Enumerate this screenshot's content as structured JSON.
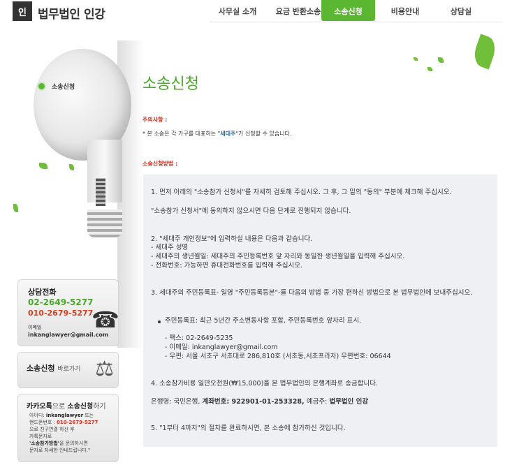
{
  "logo": {
    "mark": "인",
    "name": "법무법인 인강"
  },
  "nav": {
    "items": [
      {
        "label": "사무실 소개"
      },
      {
        "label": "요금 반환소송"
      },
      {
        "label": "소송신청"
      },
      {
        "label": "비용안내"
      },
      {
        "label": "상담실"
      }
    ],
    "active_index": 2
  },
  "bulb": {
    "label": "소송신청"
  },
  "sidebar": {
    "phone_box": {
      "title": "상담전화",
      "phone1": "02-2649-5277",
      "phone2": "010-2679-5277",
      "email_label": "이메일",
      "email": "inkanglawyer@gmail.com"
    },
    "apply_box": {
      "title": "소송신청",
      "title_suffix": "바로가기"
    },
    "kakao_box": {
      "title_main": "카카오톡",
      "title_mid": "으로 ",
      "title_bold": "소송신청",
      "title_end": "하기",
      "line1_prefix": "아이디: ",
      "line1_id": "inkanglawyer",
      "line1_suffix": " 또는",
      "line2_prefix": "핸드폰번호 : ",
      "line2_num": "010-2679-5277",
      "line3": "으로 친구연결 하신 후",
      "line4": "카톡문자로",
      "line5_quote": "'소송참가방법'",
      "line5_suffix": "을 문의하시면",
      "line6": "문자로 자세한 안내드립니다.\""
    }
  },
  "main": {
    "title": "소송신청",
    "notice_label": "주의사항 :",
    "notice_prefix": "* 본 소송은 각 가구를 대표하는 \"",
    "notice_highlight": "세대주",
    "notice_suffix": "\"가 신청할 수 있습니다.",
    "method_label": "소송신청방법 :",
    "steps": {
      "s1_line1": "1. 먼저 아래의 \"소송참가 신청서\"를 자세히 검토해 주십시오. 그 후, 그 밑의 \"동의\" 부분에 체크해 주십시오.",
      "s1_line2": "\"소송참가 신청서\"에 동의하지 않으시면 다음 단계로 진행되지 않습니다.",
      "s2_line1": "2. \"세대주 개인정보\"에 입력하실 내용은 다음과 같습니다.",
      "s2_line2": "- 세대주 성명",
      "s2_line3": "- 세대주의 생년월일: 세대주의 주민등록번호 앞 자리와 동일한 생년월일을 입력해 주십시오.",
      "s2_line4": "- 전화번호: 가능하면 휴대전화번호를 입력해 주십시오.",
      "s3_line1": "3. 세대주의 주민등록표- 일명 \"주민등록등본\"-를 다음의 방법 중 가장 편하신 방법으로 본 법무법인에 보내주십시오.",
      "s3_bullet": "주민등록표: 최근 5년간 주소변동사항 포함, 주민등록번호 앞자리 표시.",
      "s3_fax": "- 팩스: 02-2649-5235",
      "s3_email": "- 이메일: inkanglawyer@gmail.com",
      "s3_mail": "- 우편: 서울 서초구 서초대로 286,810호 (서초동,서초프라자) 우편번호: 06644",
      "s4_line1": "4. 소송참가비용 일만오천원(₩15,000)을 본 법무법인의 은행계좌로 송금합니다.",
      "s4_bank_prefix": "은행명: 국민은행, ",
      "s4_account_label": "계좌번호: 922901-01-253328, ",
      "s4_holder_prefix": "예금주: ",
      "s4_holder": "법무법인 인강",
      "s5_line1": "5. \"1부터 4까지\"의 절차를 완료하시면, 본 소송에 참가하신 것입니다."
    }
  },
  "colors": {
    "accent": "#5bb731",
    "title_green": "#4aa82a",
    "label_red": "#d03020",
    "panel_bg": "#eef0f4"
  },
  "icons": [
    "phone-icon",
    "scale-icon",
    "leaf-icon",
    "bulb-icon"
  ]
}
